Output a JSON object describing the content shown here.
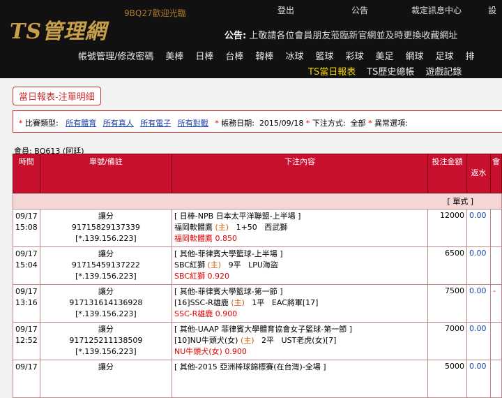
{
  "header": {
    "logo": "TS管理網",
    "welcome": "9BQ27歡迎光臨",
    "links": [
      "登出",
      "公告",
      "裁定訊息中心",
      "設"
    ],
    "announcement_label": "公告:",
    "announcement_text": "上敬請各位會員朋友蒞臨新官網並及時更換收藏網址"
  },
  "nav_main": [
    "帳號管理/修改密碼",
    "美棒",
    "日棒",
    "台棒",
    "韓棒",
    "冰球",
    "籃球",
    "彩球",
    "美足",
    "網球",
    "足球",
    "排"
  ],
  "nav_sub": [
    "TS當日報表",
    "TS歷史總帳",
    "遊戲記錄"
  ],
  "page_title": "當日報表-注單明細",
  "filter": {
    "type_label": "比賽類型:",
    "types": [
      "所有體育",
      "所有真人",
      "所有電子",
      "所有對戰"
    ],
    "date_label": "帳務日期:",
    "date_value": "2015/09/18",
    "method_label": "下注方式:",
    "method_value": "全部",
    "abnormal_label": "異常選項:"
  },
  "member": "會員: BQ613 (阿廷)",
  "table": {
    "headers": {
      "time": "時間",
      "id": "單號/備註",
      "content": "下注內容",
      "amount": "投注金額",
      "rebate": "返水",
      "extra": "會"
    },
    "section": "[ 單式 ]",
    "rows": [
      {
        "date": "09/17",
        "time": "15:08",
        "type": "讓分",
        "id": "91715829137339",
        "ip": "[*.139.156.223]",
        "league": "[ 日棒-NPB 日本太平洋聯盟-上半場 ]",
        "home": "福岡軟體鷹",
        "mark": "(主)",
        "line": "1+50",
        "away": "西武獅",
        "pick": "福岡軟體鷹",
        "odds": "0.850",
        "amount": "12000",
        "rebate": "0.00",
        "extra": ""
      },
      {
        "date": "09/17",
        "time": "15:04",
        "type": "讓分",
        "id": "91715459137222",
        "ip": "[*.139.156.223]",
        "league": "[ 其他-菲律賓大學籃球-上半場 ]",
        "home": "SBC紅獅",
        "mark": "(主)",
        "line": "9平",
        "away": "LPU海盜",
        "pick": "SBC紅獅",
        "odds": "0.920",
        "amount": "6500",
        "rebate": "0.00",
        "extra": ""
      },
      {
        "date": "09/17",
        "time": "13:16",
        "type": "讓分",
        "id": "917131614136928",
        "ip": "[*.139.156.223]",
        "league": "[ 其他-菲律賓大學籃球-第一節 ]",
        "home": "[16]SSC-R雄鹿",
        "mark": "(主)",
        "line": "1平",
        "away": "EAC將軍[17]",
        "pick": "SSC-R雄鹿",
        "odds": "0.900",
        "amount": "7500",
        "rebate": "0.00",
        "extra": "-"
      },
      {
        "date": "09/17",
        "time": "12:52",
        "type": "讓分",
        "id": "917125211138509",
        "ip": "[*.139.156.223]",
        "league": "[ 其他-UAAP 菲律賓大學體育協會女子籃球-第一節 ]",
        "home": "[10]NU牛頭犬(女)",
        "mark": "(主)",
        "line": "2平",
        "away": "UST老虎(女)[7]",
        "pick": "NU牛頭犬(女)",
        "odds": "0.900",
        "amount": "7000",
        "rebate": "0.00",
        "extra": ""
      },
      {
        "date": "09/17",
        "time": "",
        "type": "讓分",
        "id": "",
        "ip": "",
        "league": "[ 其他-2015 亞洲棒球錦標賽(在台灣)-全場 ]",
        "home": "",
        "mark": "",
        "line": "",
        "away": "",
        "pick": "",
        "odds": "",
        "amount": "5000",
        "rebate": "0.00",
        "extra": ""
      }
    ]
  },
  "colors": {
    "header_red": "#c8102e",
    "link_blue": "#1a3fa8",
    "accent_gold": "#c9a04a",
    "nav_yellow": "#f0d000"
  }
}
